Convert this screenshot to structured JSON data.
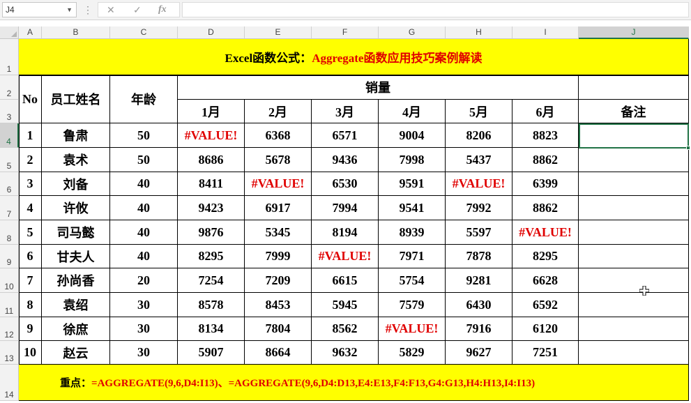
{
  "formula_bar": {
    "name_box": "J4",
    "formula": ""
  },
  "sheet": {
    "columns": [
      "A",
      "B",
      "C",
      "D",
      "E",
      "F",
      "G",
      "H",
      "I",
      "J"
    ],
    "rows": [
      "1",
      "2",
      "3",
      "4",
      "5",
      "6",
      "7",
      "8",
      "9",
      "10",
      "11",
      "12",
      "13",
      "14"
    ],
    "selected_cell": "J4",
    "title_black": "Excel函数公式：",
    "title_red": "Aggregate函数应用技巧案例解读",
    "headers": {
      "no": "No",
      "name": "员工姓名",
      "age": "年龄",
      "sales": "销量",
      "months": [
        "1月",
        "2月",
        "3月",
        "4月",
        "5月",
        "6月"
      ],
      "remark": "备注"
    },
    "data_rows": [
      {
        "no": "1",
        "name": "鲁肃",
        "age": "50",
        "sales": [
          "#VALUE!",
          "6368",
          "6571",
          "9004",
          "8206",
          "8823"
        ]
      },
      {
        "no": "2",
        "name": "袁术",
        "age": "50",
        "sales": [
          "8686",
          "5678",
          "9436",
          "7998",
          "5437",
          "8862"
        ]
      },
      {
        "no": "3",
        "name": "刘备",
        "age": "40",
        "sales": [
          "8411",
          "#VALUE!",
          "6530",
          "9591",
          "#VALUE!",
          "6399"
        ]
      },
      {
        "no": "4",
        "name": "许攸",
        "age": "40",
        "sales": [
          "9423",
          "6917",
          "7994",
          "9541",
          "7992",
          "8862"
        ]
      },
      {
        "no": "5",
        "name": "司马懿",
        "age": "40",
        "sales": [
          "9876",
          "5345",
          "8194",
          "8939",
          "5597",
          "#VALUE!"
        ]
      },
      {
        "no": "6",
        "name": "甘夫人",
        "age": "40",
        "sales": [
          "8295",
          "7999",
          "#VALUE!",
          "7971",
          "7878",
          "8295"
        ]
      },
      {
        "no": "7",
        "name": "孙尚香",
        "age": "20",
        "sales": [
          "7254",
          "7209",
          "6615",
          "5754",
          "9281",
          "6628"
        ]
      },
      {
        "no": "8",
        "name": "袁绍",
        "age": "30",
        "sales": [
          "8578",
          "8453",
          "5945",
          "7579",
          "6430",
          "6592"
        ]
      },
      {
        "no": "9",
        "name": "徐庶",
        "age": "30",
        "sales": [
          "8134",
          "7804",
          "8562",
          "#VALUE!",
          "7916",
          "6120"
        ]
      },
      {
        "no": "10",
        "name": "赵云",
        "age": "30",
        "sales": [
          "5907",
          "8664",
          "9632",
          "5829",
          "9627",
          "7251"
        ]
      }
    ],
    "footer_label": "重点：",
    "footer_formula": "=AGGREGATE(9,6,D4:I13)、=AGGREGATE(9,6,D4:D13,E4:E13,F4:F13,G4:G13,H4:H13,I4:I13)"
  },
  "colors": {
    "highlight": "#ffff00",
    "error_text": "#e00000",
    "selection": "#217346"
  }
}
